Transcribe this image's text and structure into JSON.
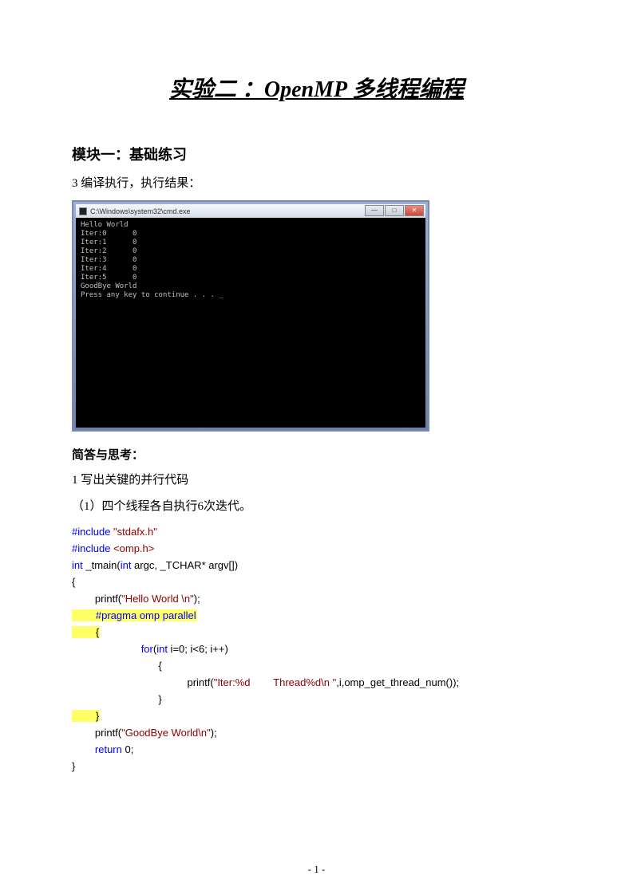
{
  "title": "实验二 ：OpenMP 多线程编程",
  "module1": {
    "heading": "模块一：基础练习",
    "item3": "3    编译执行，执行结果："
  },
  "console": {
    "path": "C:\\Windows\\system32\\cmd.exe",
    "output": "Hello World\nIter:0      0\nIter:1      0\nIter:2      0\nIter:3      0\nIter:4      0\nIter:5      0\nGoodBye World\nPress any key to continue . . . _"
  },
  "qa": {
    "heading": "简答与思考：",
    "item1": "1    写出关键的并行代码",
    "sub1": "（1）四个线程各自执行6次迭代。"
  },
  "code": {
    "l1_include": "#include",
    "l1_str": " \"stdafx.h\"",
    "l2_include": "#include",
    "l2_str": " <omp.h>",
    "l3_int": "int",
    "l3_mid": " _tmain(",
    "l3_int2": "int",
    "l3_rest": " argc, _TCHAR* argv[])",
    "l4": "{",
    "l5_pre": "        printf(",
    "l5_str": "\"Hello World \\n\"",
    "l5_post": ");",
    "l6_pragma": "        #pragma",
    "l6_rest": " omp",
    "l6_par": " parallel",
    "l7": "        {",
    "l8_pre": "                        ",
    "l8_for": "for",
    "l8_mid": "(",
    "l8_int": "int",
    "l8_rest": " i=0; i<6; i++)",
    "l9": "                              {",
    "l10_pre": "                                        printf(",
    "l10_str": "\"Iter:%d        Thread%d\\n \"",
    "l10_post": ",i,omp_get_thread_num());",
    "l11": "                              }",
    "l12": "        }",
    "l13_pre": "        printf(",
    "l13_str": "\"GoodBye World\\n\"",
    "l13_post": ");",
    "l14_pre": "        ",
    "l14_ret": "return",
    "l14_post": " 0;",
    "l15": "}"
  },
  "pagenum": "- 1 -"
}
